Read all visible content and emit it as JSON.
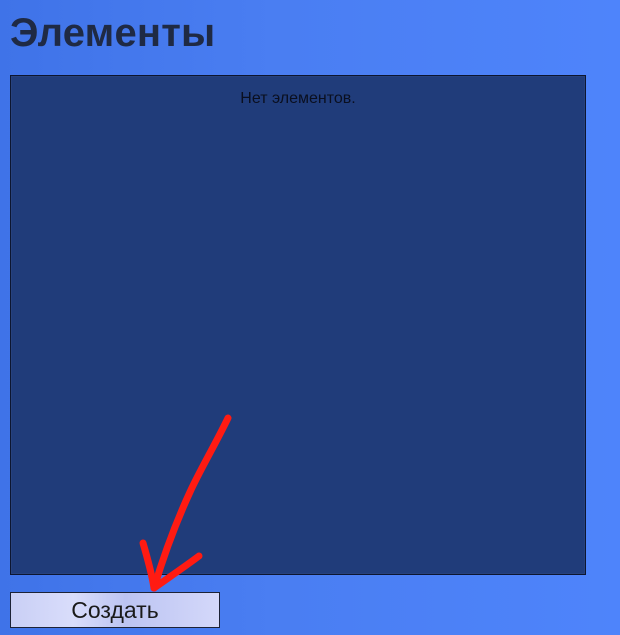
{
  "page": {
    "title": "Элементы"
  },
  "list": {
    "empty_text": "Нет элементов."
  },
  "actions": {
    "create_label": "Создать"
  },
  "annotation": {
    "icon": "arrow-icon",
    "color": "#ff1b12"
  }
}
